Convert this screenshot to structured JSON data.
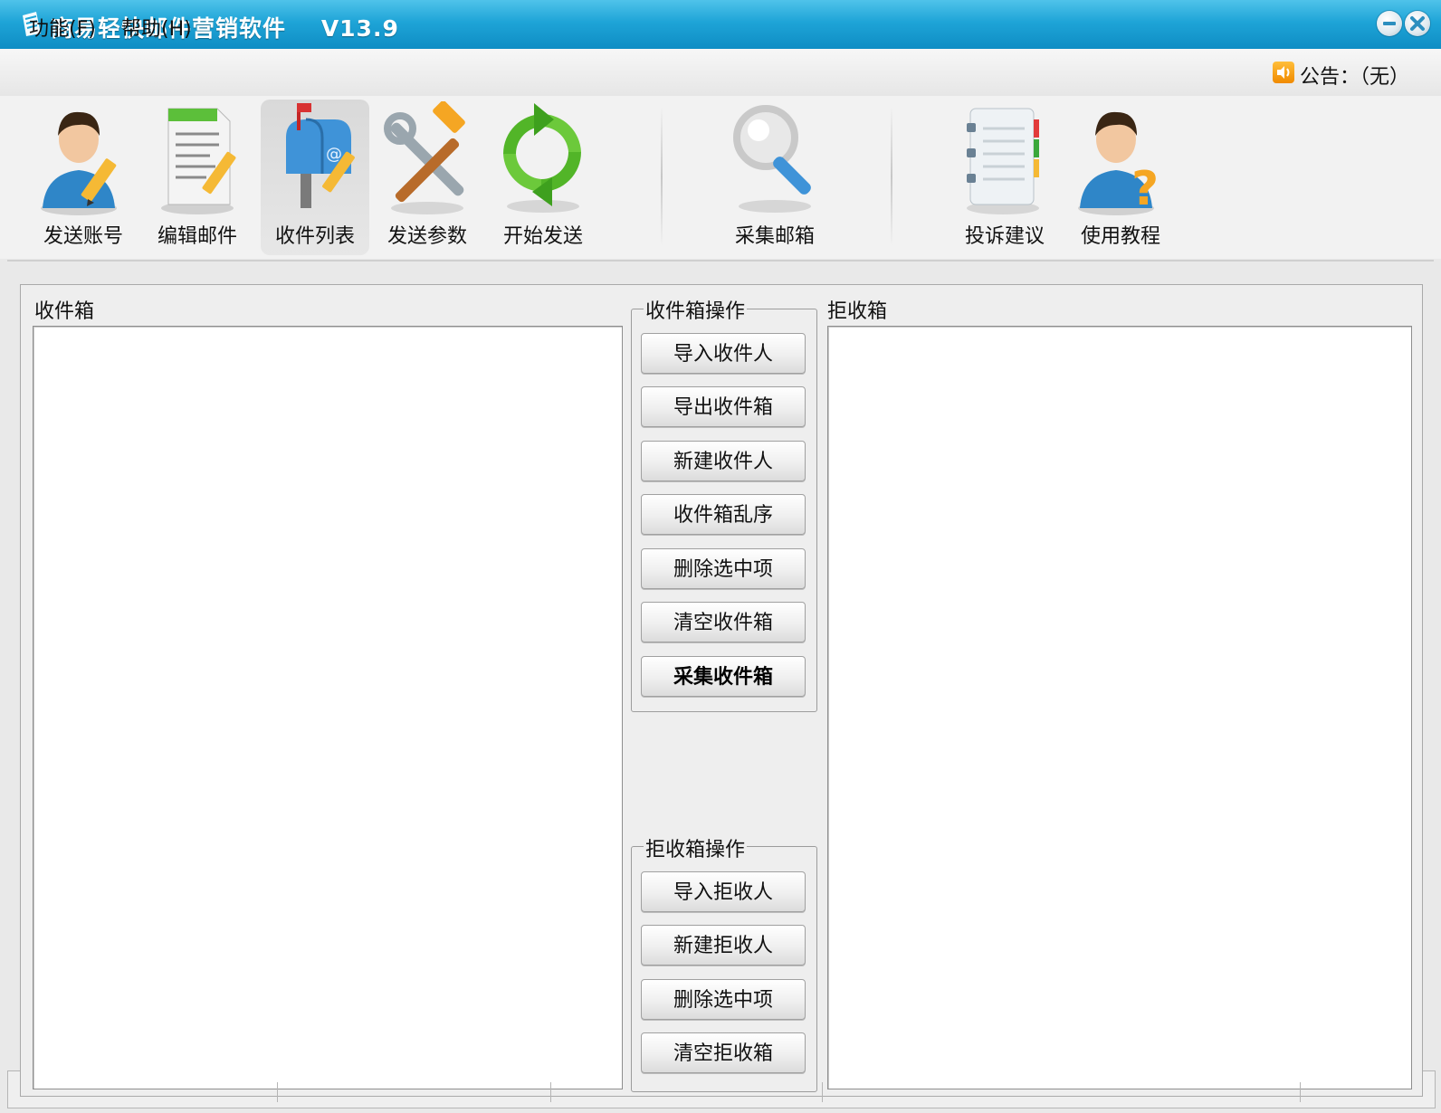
{
  "window": {
    "title": "商易轻快邮件营销软件    V13.9"
  },
  "menubar": {
    "items": [
      {
        "label": "功能(F)"
      },
      {
        "label": "帮助(H)"
      }
    ],
    "notice": "公告：（无）"
  },
  "toolbar": {
    "items": [
      {
        "label": "发送账号",
        "icon": "user-edit-icon"
      },
      {
        "label": "编辑邮件",
        "icon": "document-edit-icon"
      },
      {
        "label": "收件列表",
        "icon": "mailbox-icon",
        "active": true
      },
      {
        "label": "发送参数",
        "icon": "tools-icon"
      },
      {
        "label": "开始发送",
        "icon": "refresh-icon"
      },
      {
        "label": "采集邮箱",
        "icon": "magnifier-icon"
      },
      {
        "label": "投诉建议",
        "icon": "notebook-icon"
      },
      {
        "label": "使用教程",
        "icon": "user-help-icon"
      }
    ]
  },
  "main": {
    "inbox_title": "收件箱",
    "reject_title": "拒收箱",
    "inbox_ops": {
      "title": "收件箱操作",
      "buttons": [
        "导入收件人",
        "导出收件箱",
        "新建收件人",
        "收件箱乱序",
        "删除选中项",
        "清空收件箱",
        "采集收件箱"
      ]
    },
    "reject_ops": {
      "title": "拒收箱操作",
      "buttons": [
        "导入拒收人",
        "新建拒收人",
        "删除选中项",
        "清空拒收箱"
      ]
    }
  },
  "colors": {
    "titlebar": "#1ea4d7",
    "accent_orange": "#f08a00"
  }
}
